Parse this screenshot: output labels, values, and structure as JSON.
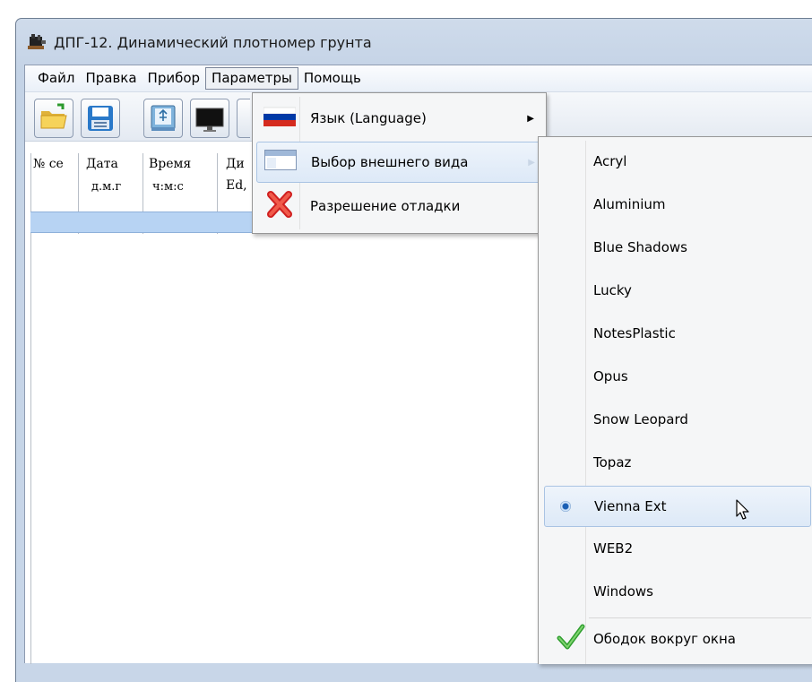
{
  "window": {
    "title": "ДПГ-12. Динамический плотномер грунта"
  },
  "menubar": [
    {
      "label": "Файл"
    },
    {
      "label": "Правка"
    },
    {
      "label": "Прибор"
    },
    {
      "label": "Параметры",
      "active": true
    },
    {
      "label": "Помощь"
    }
  ],
  "toolbar": {
    "buttons": [
      {
        "icon": "folder-open-icon"
      },
      {
        "icon": "save-disk-icon"
      },
      {
        "icon": "usb-device-icon"
      },
      {
        "icon": "monitor-icon"
      }
    ]
  },
  "table": {
    "headers": [
      "№ се",
      "Дата",
      "Время",
      "Ди"
    ],
    "subheaders": [
      "",
      "д.м.г",
      "ч:м:с",
      "Ed,"
    ]
  },
  "params_menu": {
    "items": [
      {
        "label": "Язык (Language)",
        "icon": "russian-flag-icon",
        "has_submenu": true
      },
      {
        "label": "Выбор внешнего вида",
        "icon": "window-appearance-icon",
        "has_submenu": true,
        "highlighted": true
      },
      {
        "label": "Разрешение отладки",
        "icon": "red-cross-icon"
      }
    ]
  },
  "appearance_menu": {
    "items": [
      {
        "label": "Acryl"
      },
      {
        "label": "Aluminium"
      },
      {
        "label": "Blue Shadows"
      },
      {
        "label": "Lucky"
      },
      {
        "label": "NotesPlastic"
      },
      {
        "label": "Opus"
      },
      {
        "label": "Snow Leopard"
      },
      {
        "label": "Topaz"
      },
      {
        "label": "Vienna Ext",
        "selected": true,
        "highlighted": true
      },
      {
        "label": "WEB2"
      },
      {
        "label": "Windows"
      },
      {
        "label": "Ободок вокруг окна",
        "checked": true
      }
    ]
  },
  "colors": {
    "accent": "#b7d3f3",
    "highlight_border": "#a9c3e3",
    "check": "#3fa83a",
    "flag_red": "#d52b1e",
    "flag_blue": "#0039a6"
  }
}
